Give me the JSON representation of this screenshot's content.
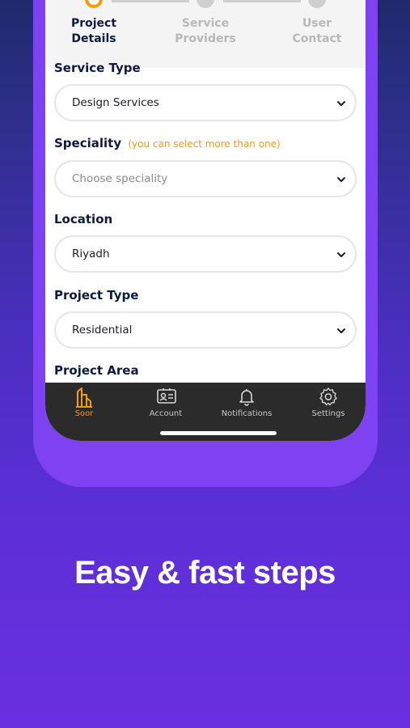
{
  "stepper": {
    "steps": [
      {
        "line1": "Project",
        "line2": "Details",
        "state": "active"
      },
      {
        "line1": "Service",
        "line2": "Providers",
        "state": "idle"
      },
      {
        "line1": "User",
        "line2": "Contact",
        "state": "idle"
      }
    ]
  },
  "form": {
    "service_type": {
      "label": "Service Type",
      "value": "Design Services"
    },
    "speciality": {
      "label": "Speciality",
      "hint": "(you can select more than one)",
      "placeholder": "Choose speciality"
    },
    "location": {
      "label": "Location",
      "value": "Riyadh"
    },
    "project_type": {
      "label": "Project Type",
      "value": "Residential"
    },
    "project_area": {
      "label": "Project Area"
    }
  },
  "tabbar": {
    "items": [
      {
        "label": "Soor",
        "icon": "soor-building-icon",
        "active": true
      },
      {
        "label": "Account",
        "icon": "id-card-icon",
        "active": false
      },
      {
        "label": "Notifications",
        "icon": "bell-icon",
        "active": false
      },
      {
        "label": "Settings",
        "icon": "gear-icon",
        "active": false
      }
    ]
  },
  "headline": "Easy & fast steps",
  "colors": {
    "accent": "#f39c12",
    "phone_frame": "#7f42f2",
    "tabbar_bg": "#2b2b2b",
    "text_dark": "#0f1b3d"
  }
}
